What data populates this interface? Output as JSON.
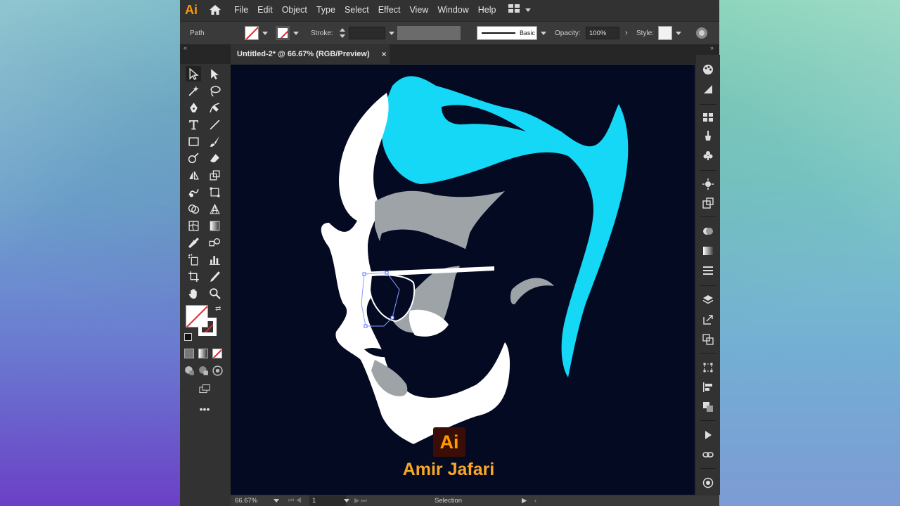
{
  "app": {
    "logo": "Ai",
    "menu": [
      "File",
      "Edit",
      "Object",
      "Type",
      "Select",
      "Effect",
      "View",
      "Window",
      "Help"
    ]
  },
  "control_bar": {
    "selection_type": "Path",
    "stroke_label": "Stroke:",
    "brush_label": "Basic",
    "opacity_label": "Opacity:",
    "opacity_value": "100%",
    "style_label": "Style:"
  },
  "document": {
    "tab_title": "Untitled-2* @ 66.67% (RGB/Preview)",
    "close_glyph": "×"
  },
  "artwork": {
    "logo_text": "Ai",
    "author": "Amir Jafari",
    "colors": {
      "background": "#040a22",
      "hair": "#14d8f5",
      "face": "#ffffff",
      "shade": "#9ea3a8",
      "accent": "#f9a825"
    }
  },
  "status_bar": {
    "zoom": "66.67%",
    "artboard": "1",
    "tool": "Selection"
  }
}
